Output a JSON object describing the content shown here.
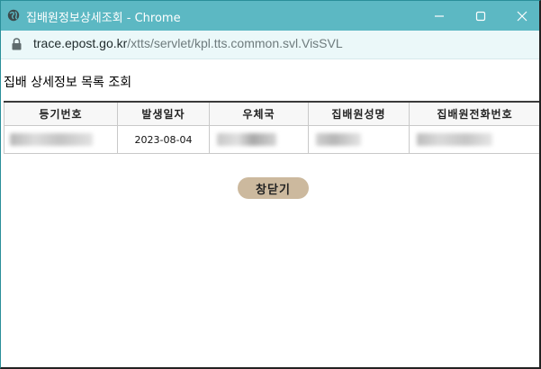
{
  "window": {
    "title": "집배원정보상세조회 - Chrome",
    "controls": {
      "minimize": "minimize",
      "maximize": "maximize",
      "close": "close"
    }
  },
  "address": {
    "host": "trace.epost.go.kr",
    "path": "/xtts/servlet/kpl.tts.common.svl.VisSVL"
  },
  "page": {
    "title": "집배 상세정보 목록 조회",
    "close_button": "창닫기"
  },
  "table": {
    "headers": [
      "등기번호",
      "발생일자",
      "우체국",
      "집배원성명",
      "집배원전화번호"
    ],
    "rows": [
      {
        "registry_no": "",
        "date": "2023-08-04",
        "office": "",
        "carrier_name": "",
        "carrier_phone": ""
      }
    ]
  },
  "colors": {
    "titlebar": "#5cb8c3",
    "addressbar": "#ebf8f9",
    "close_button": "#ccb99e"
  }
}
